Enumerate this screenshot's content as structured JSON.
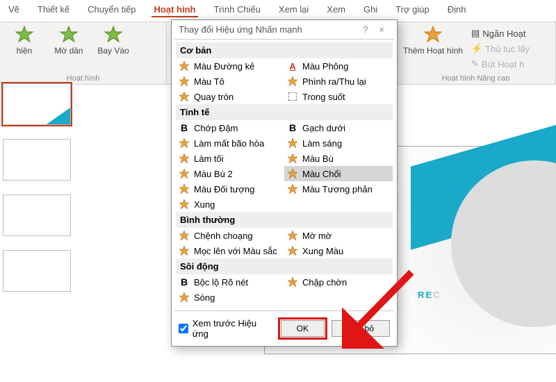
{
  "tabs": {
    "t0": "Vẽ",
    "t1": "Thiết kế",
    "t2": "Chuyển tiếp",
    "t3": "Hoạt hình",
    "t4": "Trình Chiếu",
    "t5": "Xem lại",
    "t6": "Xem",
    "t7": "Ghi",
    "t8": "Trợ giúp",
    "t9": "Định"
  },
  "ribbon": {
    "anim0": "hiện",
    "anim1": "Mờ dần",
    "anim2": "Bay Vào",
    "add_anim": "Thêm Hoạt hình",
    "pane": "Ngăn Hoạt",
    "trig": "Thủ tục lấy",
    "paint": "Bút Hoạt h",
    "grp_anim": "Hoạt hình",
    "grp_adv": "Hoạt hình Nâng cao"
  },
  "canvas": {
    "re": "RE",
    "c": "C"
  },
  "dialog": {
    "title": "Thay đổi Hiệu ứng Nhấn mạnh",
    "help": "?",
    "close": "×",
    "cat_basic": "Cơ bản",
    "basic": [
      [
        "Màu Đường kẻ",
        "star"
      ],
      [
        "Màu Phông",
        "font"
      ],
      [
        "Màu Tô",
        "star"
      ],
      [
        "Phình ra/Thu lại",
        "star"
      ],
      [
        "Quay tròn",
        "star"
      ],
      [
        "Trong suốt",
        "box"
      ]
    ],
    "cat_subtle": "Tinh tế",
    "subtle": [
      [
        "Chớp Đậm",
        "bold"
      ],
      [
        "Gạch dưới",
        "bold"
      ],
      [
        "Làm mất bão hòa",
        "star"
      ],
      [
        "Làm sáng",
        "star"
      ],
      [
        "Làm tối",
        "star"
      ],
      [
        "Màu Bù",
        "star"
      ],
      [
        "Màu Bù 2",
        "star"
      ],
      [
        "Màu Chổi",
        "star"
      ],
      [
        "Màu Đối tượng",
        "star"
      ],
      [
        "Màu Tương phản",
        "star"
      ],
      [
        "Xung",
        "star"
      ]
    ],
    "cat_moderate": "Bình thường",
    "moderate": [
      [
        "Chệnh choạng",
        "star"
      ],
      [
        "Mờ mờ",
        "star"
      ],
      [
        "Mọc lên với Màu sắc",
        "star"
      ],
      [
        "Xung Màu",
        "star"
      ]
    ],
    "cat_exciting": "Sôi động",
    "exciting": [
      [
        "Bộc lộ Rõ nét",
        "bold"
      ],
      [
        "Chập chờn",
        "star"
      ],
      [
        "Sóng",
        "star"
      ]
    ],
    "preview": "Xem trước Hiệu ứng",
    "ok": "OK",
    "cancel": "Hủy bỏ"
  }
}
